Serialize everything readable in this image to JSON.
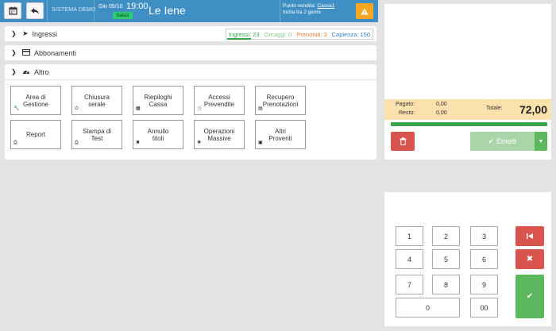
{
  "header": {
    "system_label": "SISTEMA DEMO",
    "date": "Gio 05/10",
    "time": "19:00",
    "sala": "Sala2",
    "title": "Le Iene",
    "pv_label": "Punto vendita: ",
    "pv_link": "Cassa1",
    "pv_sub": "Inizia tra 2 giorni"
  },
  "sections": {
    "ingressi": "Ingressi",
    "abbonamenti": "Abbonamenti",
    "altro": "Altro"
  },
  "stats": {
    "ingressi": "Ingressi: 23",
    "omaggi": "Omaggi: 0",
    "prenotati": "Prenotati: 3",
    "capienza": "Capienza: 150"
  },
  "tiles": [
    {
      "line1": "Area di",
      "line2": "Gestione",
      "icon": "wrench-icon"
    },
    {
      "line1": "Chiusura",
      "line2": "serale",
      "icon": "power-icon"
    },
    {
      "line1": "Riepiloghi",
      "line2": "Cassa",
      "icon": "calculator-icon"
    },
    {
      "line1": "Accessi",
      "line2": "Prevendite",
      "icon": "cart-icon"
    },
    {
      "line1": "Recupero",
      "line2": "Prenotazioni",
      "icon": "book-icon"
    },
    {
      "line1": "Report",
      "line2": "",
      "icon": "print-icon"
    },
    {
      "line1": "Stampa di",
      "line2": "Test",
      "icon": "print-icon"
    },
    {
      "line1": "Annullo",
      "line2": "titoli",
      "icon": "close-icon"
    },
    {
      "line1": "Operazioni",
      "line2": "Massive",
      "icon": "cubes-icon"
    },
    {
      "line1": "Altri",
      "line2": "Proventi",
      "icon": "money-icon"
    }
  ],
  "summary": {
    "pagato_label": "Pagato:",
    "pagato_value": "0,00",
    "resto_label": "Resto:",
    "resto_value": "0,00",
    "totale_label": "Totale:",
    "totale_value": "72,00"
  },
  "actions": {
    "emetti": "Emetti"
  },
  "keypad": {
    "keys": [
      "1",
      "2",
      "3",
      "4",
      "5",
      "6",
      "7",
      "8",
      "9",
      "0",
      "00"
    ]
  },
  "colors": {
    "header": "#3f8fc4",
    "success": "#5cb85c",
    "danger": "#d9534f",
    "warning": "#f5a623",
    "summary_bg": "#fbe2ad"
  }
}
